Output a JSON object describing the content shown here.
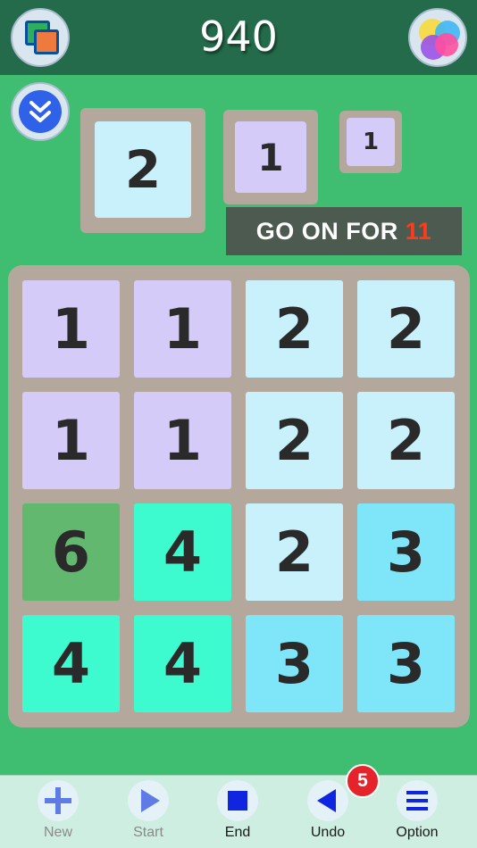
{
  "header": {
    "score": "940",
    "left_button_icon": "layers-icon",
    "right_button_icon": "game-center-icon"
  },
  "colors": {
    "background": "#3fbe72",
    "header": "#236b4a",
    "tile_1": "#d4cbf8",
    "tile_2": "#c9f1fb",
    "tile_3": "#7ee6f8",
    "tile_4": "#3dfacf",
    "tile_6": "#63b870",
    "accent_red": "#ff3b1e"
  },
  "next_tiles": [
    "2",
    "1",
    "1"
  ],
  "banner": {
    "prefix": "GO ON FOR",
    "count": "11"
  },
  "board": {
    "rows": [
      [
        "1",
        "1",
        "2",
        "2"
      ],
      [
        "1",
        "1",
        "2",
        "2"
      ],
      [
        "6",
        "4",
        "2",
        "3"
      ],
      [
        "4",
        "4",
        "3",
        "3"
      ]
    ]
  },
  "toolbar": {
    "items": [
      {
        "label": "New",
        "icon": "plus-icon",
        "enabled": false
      },
      {
        "label": "Start",
        "icon": "play-icon",
        "enabled": false
      },
      {
        "label": "End",
        "icon": "stop-icon",
        "enabled": true
      },
      {
        "label": "Undo",
        "icon": "back-triangle-icon",
        "enabled": true
      },
      {
        "label": "Option",
        "icon": "menu-icon",
        "enabled": true
      }
    ],
    "undo_badge": "5"
  }
}
